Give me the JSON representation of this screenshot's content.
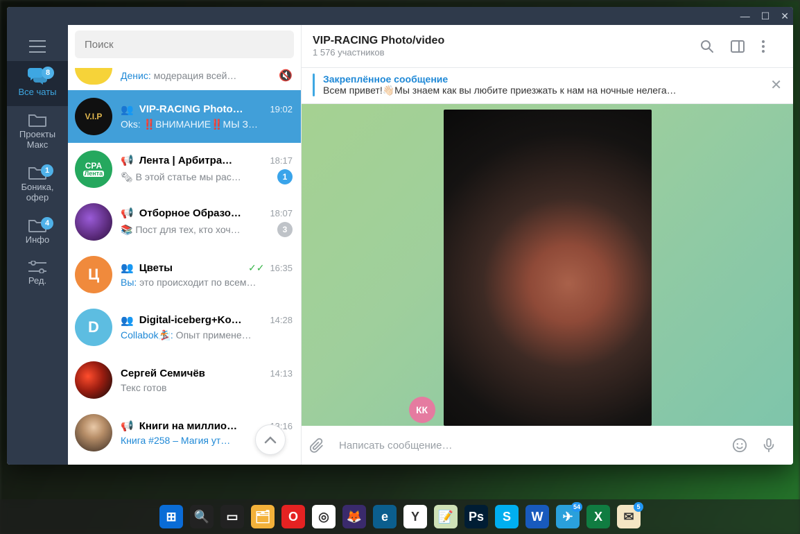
{
  "colors": {
    "accent": "#419fd9",
    "rail": "#2f3a4b",
    "link": "#1e88d6"
  },
  "search": {
    "placeholder": "Поиск"
  },
  "rail": {
    "tabs": [
      {
        "id": "all",
        "label": "Все чаты",
        "icon": "chats-icon",
        "badge": "8",
        "active": true
      },
      {
        "id": "proj",
        "label": "Проекты Макс",
        "icon": "folder-icon",
        "badge": "",
        "active": false
      },
      {
        "id": "bonika",
        "label": "Боника, офер",
        "icon": "folder-icon",
        "badge": "1",
        "active": false
      },
      {
        "id": "info",
        "label": "Инфо",
        "icon": "folder-icon",
        "badge": "4",
        "active": false
      },
      {
        "id": "edit",
        "label": "Ред.",
        "icon": "sliders-icon",
        "badge": "",
        "active": false
      }
    ]
  },
  "chats": [
    {
      "id": "partial",
      "title": "",
      "preview_prefix": "Денис:",
      "preview": " модерация всей…",
      "time": "",
      "avatar_bg": "#f6d339",
      "avatar_text": "",
      "type": "",
      "badge": "",
      "badge_blue": false,
      "status_icon": "mute-icon",
      "partial": true
    },
    {
      "id": "vip",
      "title": "VIP-RACING Photo…",
      "preview_prefix": "Oks:",
      "preview": " ‼️ВНИМАНИЕ‼️МЫ З…",
      "time": "19:02",
      "avatar_bg": "#101010",
      "avatar_text": "V.I.P",
      "avatar_text_color": "#e0b74e",
      "type": "group",
      "badge": "",
      "badge_blue": false,
      "selected": true
    },
    {
      "id": "lenta",
      "title": "Лента | Арбитра…",
      "preview_prefix": "",
      "preview": "🗞 В этой статье мы рас…",
      "time": "18:17",
      "avatar_bg": "#25a85e",
      "avatar_text": "CPA",
      "avatar_sub": "Лента",
      "type": "channel",
      "badge": "1",
      "badge_blue": true
    },
    {
      "id": "otbor",
      "title": "Отборное Образо…",
      "preview_prefix": "",
      "preview": "📚 Пост для тех, кто хоч…",
      "time": "18:07",
      "avatar_bg": "#4a2a5c",
      "avatar_text": "",
      "avatar_img": "grapes",
      "type": "channel",
      "badge": "3",
      "badge_blue": false
    },
    {
      "id": "flowers",
      "title": "Цветы",
      "preview_prefix": "Вы:",
      "preview": " это происходит по всем…",
      "time": "16:35",
      "checks": true,
      "avatar_bg": "#f08a3c",
      "avatar_text": "Ц",
      "type": "group",
      "badge": ""
    },
    {
      "id": "digital",
      "title": "Digital-iceberg+Ko…",
      "preview_prefix": "Collabok🏂:",
      "preview": " Опыт примене…",
      "time": "14:28",
      "avatar_bg": "#5dbde1",
      "avatar_text": "D",
      "type": "group",
      "badge": ""
    },
    {
      "id": "sergey",
      "title": "Сергей Семичёв",
      "preview_prefix": "",
      "preview": "Текс готов",
      "time": "14:13",
      "avatar_bg": "#111",
      "avatar_text": "",
      "avatar_img": "red",
      "type": "",
      "badge": ""
    },
    {
      "id": "books",
      "title": "Книги на миллио…",
      "preview_prefix": "",
      "preview": "Книга #258 – Магия ут…",
      "preview_link": true,
      "time": "13:16",
      "avatar_bg": "#d9c7b3",
      "avatar_text": "",
      "avatar_img": "man",
      "type": "channel",
      "badge": ""
    }
  ],
  "header": {
    "title": "VIP-RACING Photo/video",
    "subtitle": "1 576 участников"
  },
  "pinned": {
    "title": "Закреплённое сообщение",
    "text": "Всем привет!👋🏻Мы знаем как вы любите приезжать к нам на ночные нелега…"
  },
  "sender": {
    "initials": "КК",
    "color": "#e57ba0"
  },
  "composer": {
    "placeholder": "Написать сообщение…"
  },
  "taskbar": [
    {
      "name": "start-icon",
      "bg": "#0a6cd6",
      "glyph": "⊞",
      "badge": ""
    },
    {
      "name": "search-icon",
      "bg": "#222",
      "glyph": "🔍",
      "badge": ""
    },
    {
      "name": "taskview-icon",
      "bg": "#222",
      "glyph": "▭",
      "badge": ""
    },
    {
      "name": "explorer-icon",
      "bg": "#f3b13a",
      "glyph": "🗂",
      "badge": ""
    },
    {
      "name": "opera-icon",
      "bg": "#e52222",
      "glyph": "O",
      "badge": ""
    },
    {
      "name": "chrome-icon",
      "bg": "#fff",
      "glyph": "◎",
      "badge": ""
    },
    {
      "name": "firefox-icon",
      "bg": "#3a2a6c",
      "glyph": "🦊",
      "badge": ""
    },
    {
      "name": "edge-icon",
      "bg": "#0b5e8e",
      "glyph": "e",
      "badge": ""
    },
    {
      "name": "yandex-icon",
      "bg": "#fff",
      "glyph": "Y",
      "badge": ""
    },
    {
      "name": "notepad-icon",
      "bg": "#cfe2b7",
      "glyph": "📝",
      "badge": ""
    },
    {
      "name": "photoshop-icon",
      "bg": "#001d34",
      "glyph": "Ps",
      "badge": ""
    },
    {
      "name": "skype-icon",
      "bg": "#00aff0",
      "glyph": "S",
      "badge": ""
    },
    {
      "name": "word-icon",
      "bg": "#185abd",
      "glyph": "W",
      "badge": ""
    },
    {
      "name": "telegram-icon",
      "bg": "#2aa0db",
      "glyph": "✈",
      "badge": "54"
    },
    {
      "name": "excel-icon",
      "bg": "#107c41",
      "glyph": "X",
      "badge": ""
    },
    {
      "name": "mail-icon",
      "bg": "#f4e6c4",
      "glyph": "✉",
      "badge": "5"
    }
  ]
}
